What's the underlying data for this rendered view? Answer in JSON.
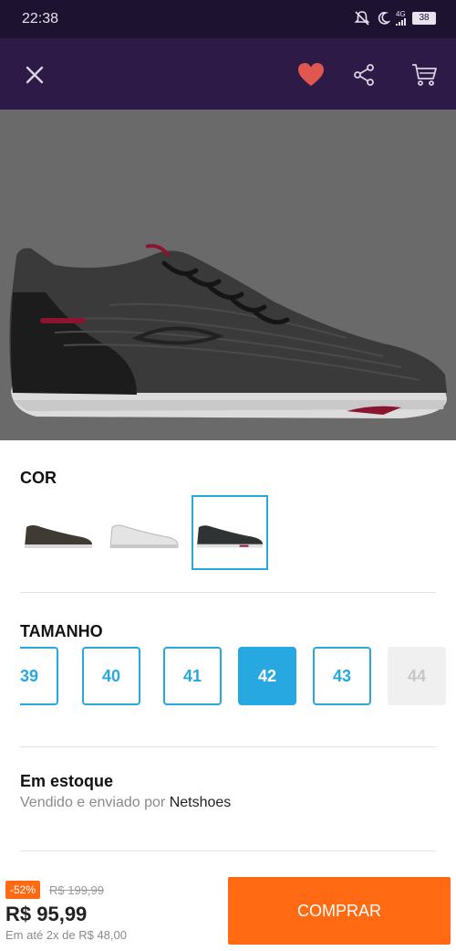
{
  "status_bar": {
    "time": "22:38",
    "network_label": "4G",
    "battery": "38",
    "icons": [
      "mute-icon",
      "moon-icon",
      "signal-icon",
      "battery-icon"
    ]
  },
  "app_bar": {
    "icons": [
      "close-icon",
      "heart-icon",
      "share-icon",
      "cart-icon"
    ],
    "favorite_color": "#e0574f",
    "background_color": "#2d1a46"
  },
  "product": {
    "image": "shoe-dark-grey-side-view",
    "color_section_title": "COR",
    "color_options": [
      {
        "name": "dark-brown-shoe",
        "selected": false
      },
      {
        "name": "white-shoe",
        "selected": false
      },
      {
        "name": "dark-grey-shoe",
        "selected": true
      }
    ],
    "size_section_title": "TAMANHO",
    "sizes": [
      {
        "label": "39",
        "state": "available"
      },
      {
        "label": "40",
        "state": "available"
      },
      {
        "label": "41",
        "state": "available"
      },
      {
        "label": "42",
        "state": "selected"
      },
      {
        "label": "43",
        "state": "available"
      },
      {
        "label": "44",
        "state": "unavailable"
      }
    ],
    "stock_title": "Em estoque",
    "sold_by_prefix": "Vendido e enviado por",
    "seller": "Netshoes"
  },
  "purchase": {
    "discount_badge": "-52%",
    "old_price": "R$ 199,99",
    "price": "R$ 95,99",
    "installments": "Em até 2x de R$ 48,00",
    "buy_label": "COMPRAR",
    "accent_color": "#ff6a13"
  },
  "colors": {
    "accent_blue": "#27a8e0",
    "status_bar": "#1d1330"
  }
}
